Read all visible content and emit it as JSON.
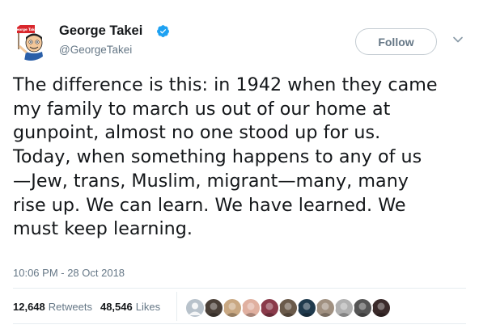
{
  "author": {
    "name": "George Takei",
    "handle": "@GeorgeTakei",
    "avatar_sign_text": "George Takei",
    "verified": true,
    "verified_color": "#1da1f2"
  },
  "actions": {
    "follow_label": "Follow",
    "more_icon": "chevron-down-icon"
  },
  "tweet": {
    "lines": [
      "The difference is this: in 1942 when they came",
      "my family to march us out of our home at",
      "gunpoint, almost no one stood up for us.",
      "Today, when something happens to any of us",
      "—Jew, trans, Muslim, migrant—many, many",
      "rise up. We can learn. We have learned. We",
      "must keep learning."
    ],
    "timestamp": "10:06 PM - 28 Oct 2018"
  },
  "stats": {
    "retweets_count": "12,648",
    "retweets_label": "Retweets",
    "likes_count": "48,546",
    "likes_label": "Likes"
  },
  "likers": [
    {
      "icon": "default-avatar",
      "color": "#b8c2cb"
    },
    {
      "icon": "avatar-photo",
      "color": "#4a4038"
    },
    {
      "icon": "avatar-photo",
      "color": "#c9a882"
    },
    {
      "icon": "avatar-photo",
      "color": "#e0b0a0"
    },
    {
      "icon": "avatar-photo",
      "color": "#8a3a4a"
    },
    {
      "icon": "avatar-photo",
      "color": "#6a5a4a"
    },
    {
      "icon": "avatar-photo",
      "color": "#1f3a4d"
    },
    {
      "icon": "avatar-photo",
      "color": "#a09080"
    },
    {
      "icon": "avatar-photo",
      "color": "#b0b0b0"
    },
    {
      "icon": "avatar-photo",
      "color": "#555555"
    },
    {
      "icon": "avatar-photo",
      "color": "#3a2a2a"
    }
  ]
}
